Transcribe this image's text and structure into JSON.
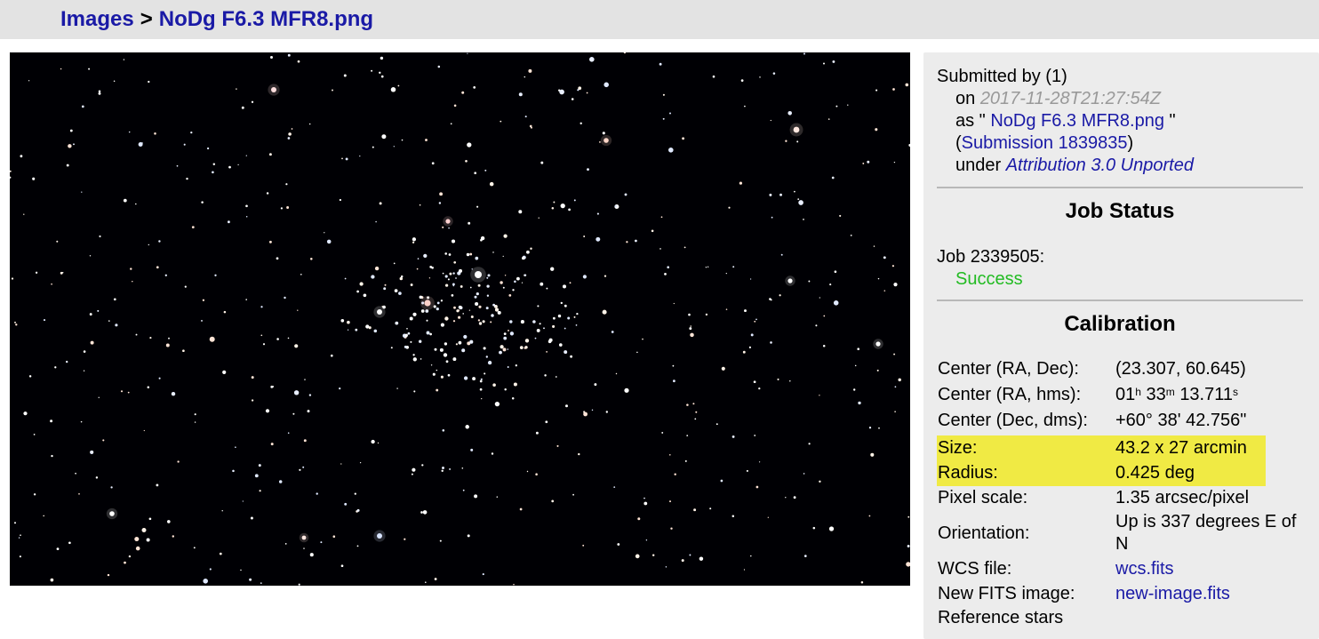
{
  "breadcrumb": {
    "root": "Images",
    "separator": ">",
    "current": "NoDg F6.3 MFR8.png"
  },
  "submission": {
    "submitted_by_label": "Submitted by",
    "submitter": "(1)",
    "on_label": "on",
    "date": "2017-11-28T21:27:54Z",
    "as_label": "as \"",
    "as_close": "\"",
    "filename": "NoDg F6.3 MFR8.png",
    "submission_open": "(",
    "submission_link": "Submission 1839835",
    "submission_close": ")",
    "under_label": "under",
    "license": "Attribution 3.0 Unported"
  },
  "job_status": {
    "heading": "Job Status",
    "job_label": "Job 2339505:",
    "status": "Success"
  },
  "calibration": {
    "heading": "Calibration",
    "center_radec_label": "Center (RA, Dec):",
    "center_radec_value": "(23.307, 60.645)",
    "center_hms_label": "Center (RA, hms):",
    "hms_h": "01",
    "hms_h_unit": "h",
    "hms_m": "33",
    "hms_m_unit": "m",
    "hms_s": "13.711",
    "hms_s_unit": "s",
    "center_dms_label": "Center (Dec, dms):",
    "center_dms_value": "+60° 38' 42.756\"",
    "size_label": "Size:",
    "size_value": "43.2 x 27 arcmin",
    "radius_label": "Radius:",
    "radius_value": "0.425 deg",
    "pixel_scale_label": "Pixel scale:",
    "pixel_scale_value": "1.35 arcsec/pixel",
    "orientation_label": "Orientation:",
    "orientation_value": "Up is 337 degrees E of N",
    "wcs_label": "WCS file:",
    "wcs_link": "wcs.fits",
    "fits_label": "New FITS image:",
    "fits_link": "new-image.fits",
    "ref_label": "Reference stars"
  },
  "colors": {
    "link": "#1a1aa6",
    "success": "#22bb22",
    "highlight": "#f0ea44",
    "panel": "#ececec"
  }
}
